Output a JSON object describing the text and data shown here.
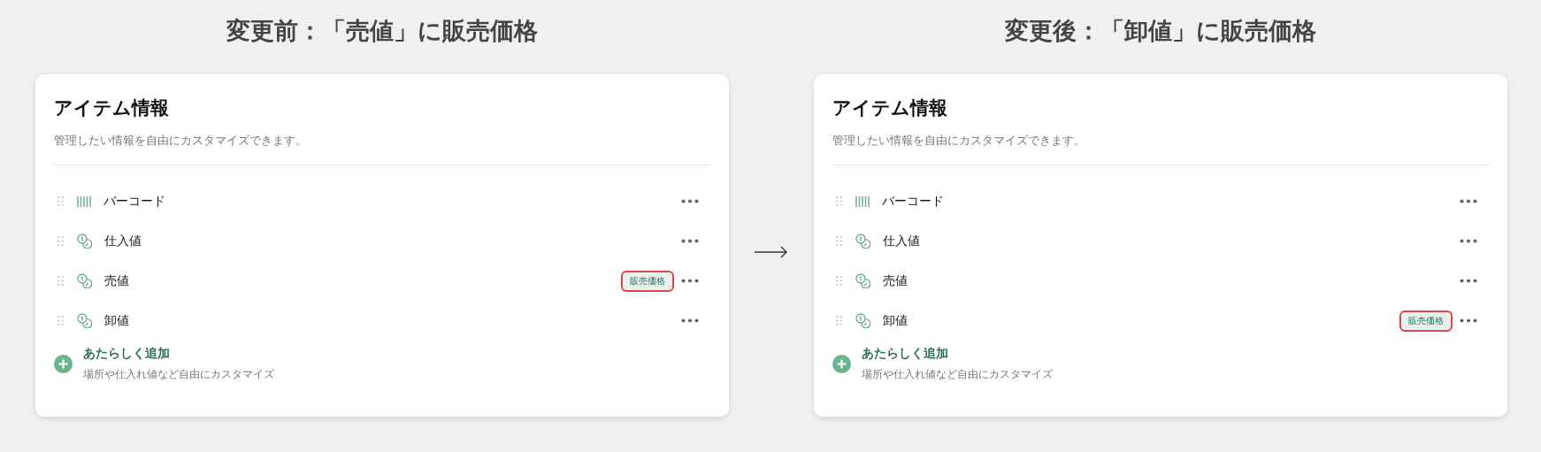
{
  "panels": [
    {
      "heading": "変更前：「売値」に販売価格",
      "card": {
        "title": "アイテム情報",
        "subtitle": "管理したい情報を自由にカスタマイズできます。",
        "items": [
          {
            "kind": "barcode",
            "label": "バーコード"
          },
          {
            "kind": "coin",
            "label": "仕入値"
          },
          {
            "kind": "coin",
            "label": "売値",
            "badge": "販売価格"
          },
          {
            "kind": "coin",
            "label": "卸値"
          }
        ],
        "add": {
          "label": "あたらしく追加",
          "hint": "場所や仕入れ値など自由にカスタマイズ"
        }
      }
    },
    {
      "heading": "変更後：「卸値」に販売価格",
      "card": {
        "title": "アイテム情報",
        "subtitle": "管理したい情報を自由にカスタマイズできます。",
        "items": [
          {
            "kind": "barcode",
            "label": "バーコード"
          },
          {
            "kind": "coin",
            "label": "仕入値"
          },
          {
            "kind": "coin",
            "label": "売値"
          },
          {
            "kind": "coin",
            "label": "卸値",
            "badge": "販売価格"
          }
        ],
        "add": {
          "label": "あたらしく追加",
          "hint": "場所や仕入れ値など自由にカスタマイズ"
        }
      }
    }
  ]
}
